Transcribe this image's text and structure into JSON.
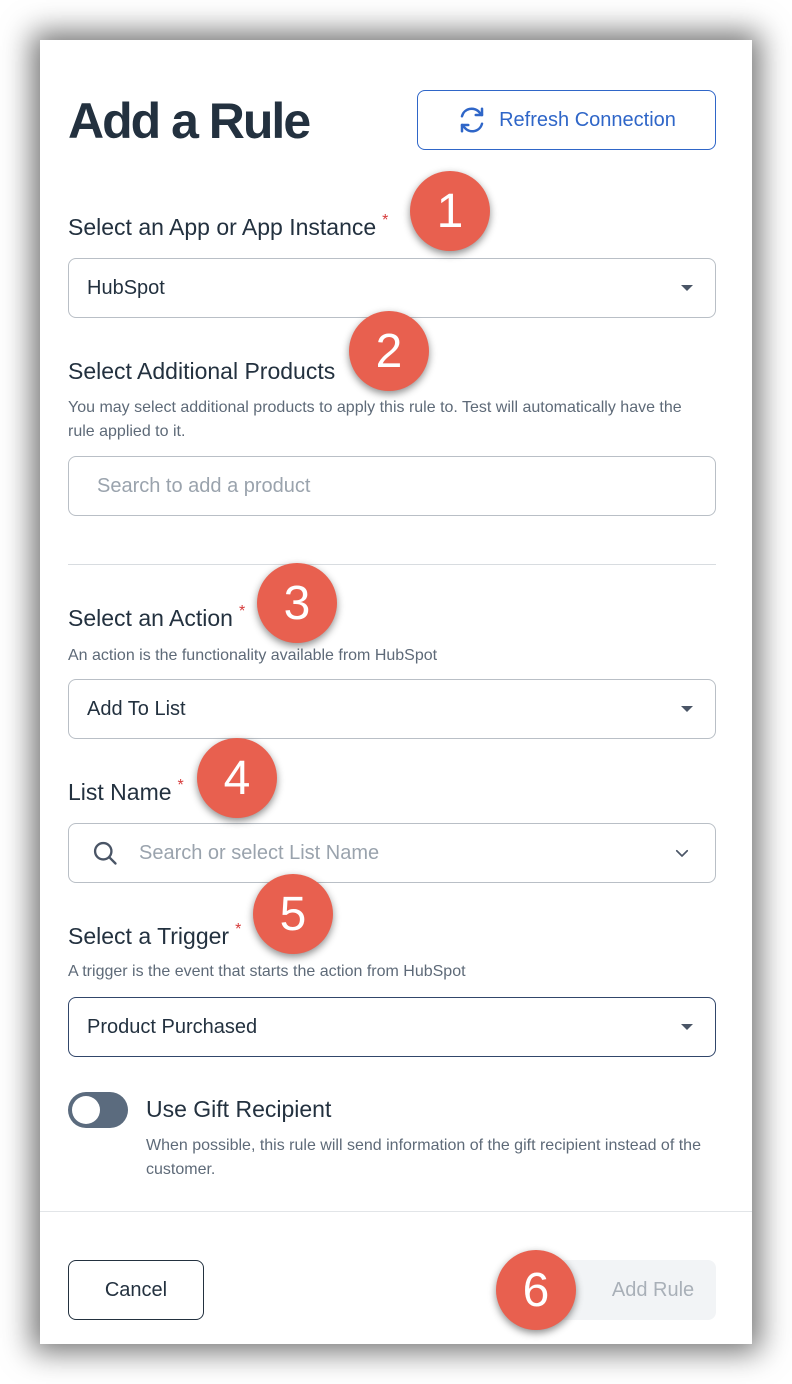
{
  "header": {
    "title": "Add a Rule",
    "refresh_label": "Refresh Connection"
  },
  "app_field": {
    "label": "Select an App or App Instance",
    "required_mark": "*",
    "value": "HubSpot"
  },
  "products_field": {
    "label": "Select Additional Products",
    "help": "You may select additional products to apply this rule to. Test will automatically have the rule applied to it.",
    "placeholder": "Search to add a product"
  },
  "action_field": {
    "label": "Select an Action",
    "required_mark": "*",
    "help": "An action is the functionality available from HubSpot",
    "value": "Add To List"
  },
  "list_field": {
    "label": "List Name",
    "required_mark": "*",
    "placeholder": "Search or select List Name"
  },
  "trigger_field": {
    "label": "Select a Trigger",
    "required_mark": "*",
    "help": "A trigger is the event that starts the action from HubSpot",
    "value": "Product Purchased"
  },
  "gift_toggle": {
    "label": "Use Gift Recipient",
    "help": "When possible, this rule will send information of the gift recipient instead of the customer.",
    "enabled": false
  },
  "footer": {
    "cancel_label": "Cancel",
    "add_label": "Add Rule"
  },
  "annotations": [
    "1",
    "2",
    "3",
    "4",
    "5",
    "6"
  ],
  "colors": {
    "accent": "#2f66c8",
    "badge": "#e8604f",
    "required": "#d63a3a",
    "toggle_off": "#5b6b7e"
  },
  "icons": {
    "refresh": "refresh-icon",
    "dropdown": "caret-down-icon",
    "search": "search-icon",
    "chevron": "chevron-down-icon"
  }
}
